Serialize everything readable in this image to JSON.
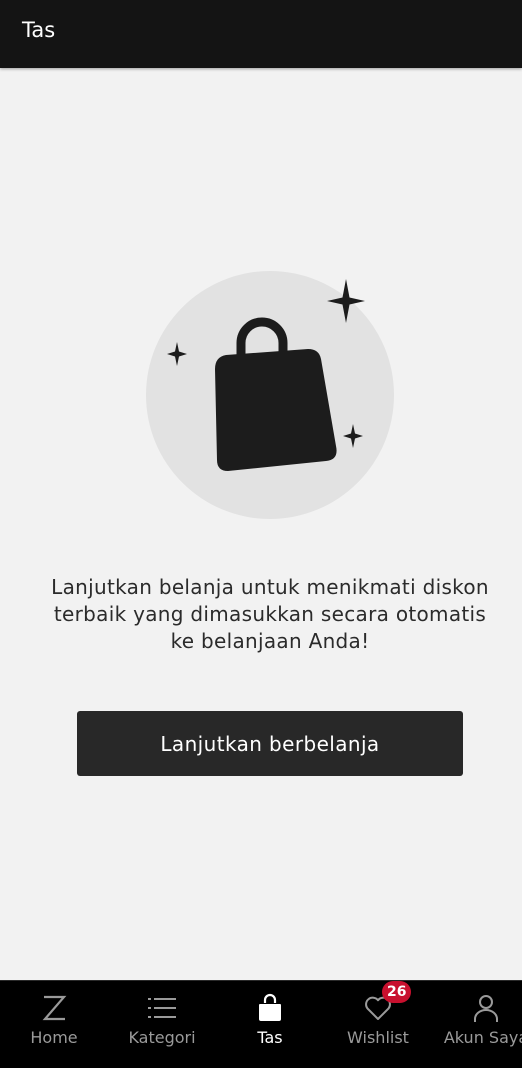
{
  "header": {
    "title": "Tas"
  },
  "empty_state": {
    "illustration_icon": "shopping-bag-with-sparkles",
    "message": "Lanjutkan belanja untuk menikmati diskon terbaik yang dimasukkan secara otomatis ke belanjaan Anda!",
    "button_label": "Lanjutkan berbelanja"
  },
  "bottom_nav": {
    "items": [
      {
        "label": "Home",
        "icon": "zalora-z-icon",
        "active": false
      },
      {
        "label": "Kategori",
        "icon": "list-icon",
        "active": false
      },
      {
        "label": "Tas",
        "icon": "bag-icon",
        "active": true
      },
      {
        "label": "Wishlist",
        "icon": "heart-icon",
        "active": false,
        "badge": "26"
      },
      {
        "label": "Akun Saya",
        "icon": "user-icon",
        "active": false
      }
    ]
  },
  "colors": {
    "header_bg": "#141414",
    "page_bg": "#f2f2f2",
    "button_bg": "#282828",
    "nav_bg": "#000000",
    "badge_bg": "#c8102e"
  }
}
